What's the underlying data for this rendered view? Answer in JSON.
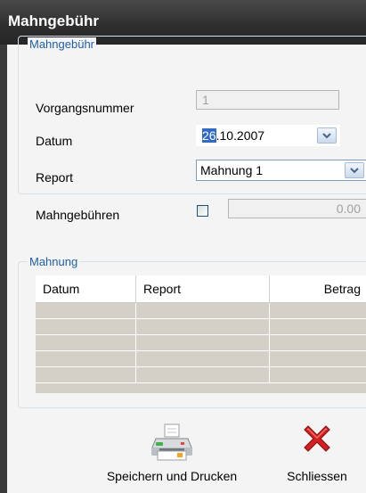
{
  "window": {
    "title": "Mahngebühr"
  },
  "group_fee": {
    "legend": "Mahngebühr",
    "vorgangsnummer": {
      "label": "Vorgangsnummer",
      "value": "1"
    },
    "datum": {
      "label": "Datum",
      "value_selected": "26",
      "value_rest": ".10.2007"
    },
    "report": {
      "label": "Report",
      "value": "Mahnung 1"
    },
    "mahngebuehren": {
      "label": "Mahngebühren",
      "checked": false,
      "value": "0.00"
    }
  },
  "group_reminder": {
    "legend": "Mahnung",
    "columns": [
      "Datum",
      "Report",
      "Betrag"
    ],
    "rows": [
      [
        "",
        "",
        ""
      ],
      [
        "",
        "",
        ""
      ],
      [
        "",
        "",
        ""
      ],
      [
        "",
        "",
        ""
      ],
      [
        "",
        "",
        ""
      ]
    ]
  },
  "actions": {
    "print_label": "Speichern und Drucken",
    "close_label": "Schliessen"
  },
  "colors": {
    "titlebar": "#2f2f2f",
    "legend": "#1f5fa9",
    "table_fill": "#d4d0c8",
    "close_icon": "#d42020"
  },
  "icons": {
    "print": "printer-icon",
    "close": "close-icon",
    "dropdown": "chevron-down-icon"
  }
}
